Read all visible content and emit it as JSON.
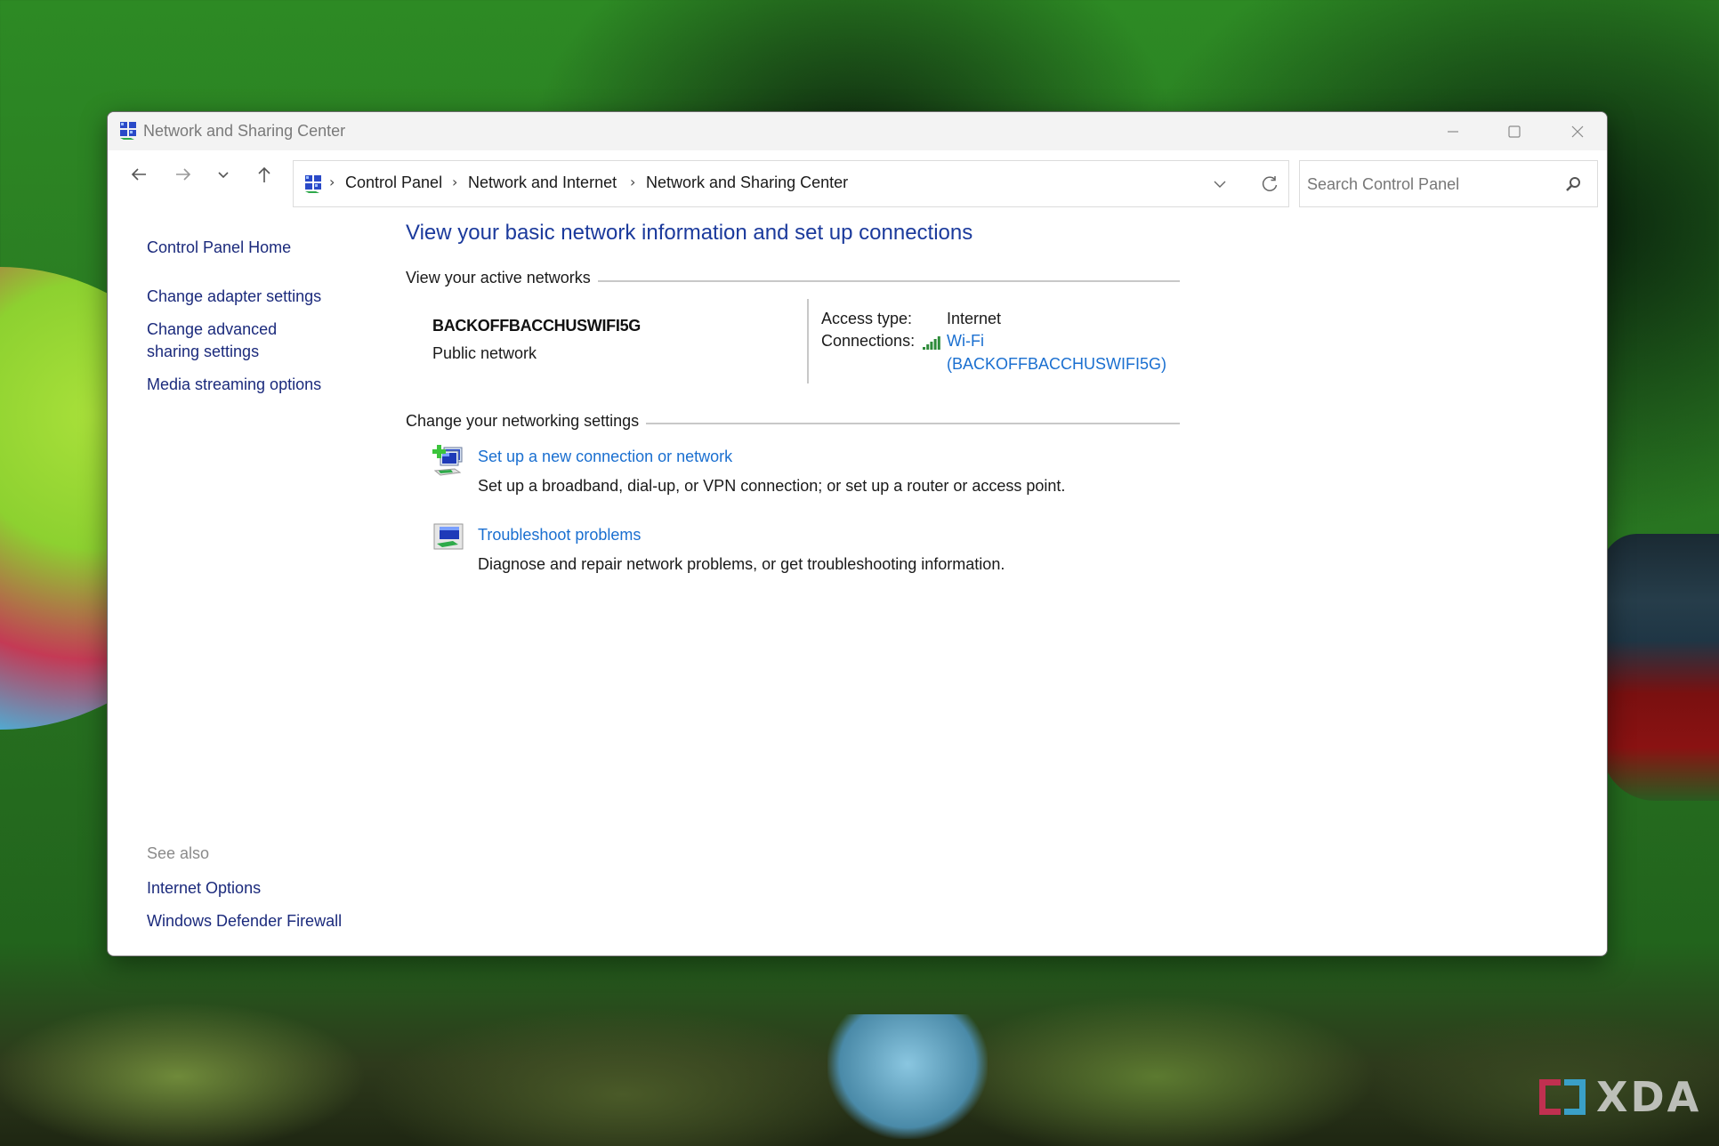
{
  "window": {
    "title": "Network and Sharing Center",
    "controls": {
      "minimize": "minimize",
      "maximize": "maximize",
      "close": "close"
    }
  },
  "navigation": {
    "back_label": "Back",
    "forward_label": "Forward",
    "recent_label": "Recent locations",
    "up_label": "Up"
  },
  "breadcrumb": {
    "separator": "›",
    "items": [
      "Control Panel",
      "Network and Internet",
      "Network and Sharing Center"
    ]
  },
  "search": {
    "placeholder": "Search Control Panel",
    "value": ""
  },
  "sidebar": {
    "home": "Control Panel Home",
    "links": [
      "Change adapter settings",
      "Change advanced sharing settings",
      "Media streaming options"
    ],
    "see_also_title": "See also",
    "see_also": [
      "Internet Options",
      "Windows Defender Firewall"
    ]
  },
  "main": {
    "heading": "View your basic network information and set up connections",
    "active_networks_label": "View your active networks",
    "network": {
      "name": "BACKOFFBACCHUSWIFI5G",
      "category": "Public network",
      "access_type_label": "Access type:",
      "access_type_value": "Internet",
      "connections_label": "Connections:",
      "connection_link_line1": "Wi-Fi",
      "connection_link_line2": "(BACKOFFBACCHUSWIFI5G)",
      "signal_bars": 5,
      "signal_max": 5
    },
    "change_settings_label": "Change your networking settings",
    "tasks": [
      {
        "icon": "new-connection-icon",
        "title": "Set up a new connection or network",
        "description": "Set up a broadband, dial-up, or VPN connection; or set up a router or access point."
      },
      {
        "icon": "troubleshoot-icon",
        "title": "Troubleshoot problems",
        "description": "Diagnose and repair network problems, or get troubleshooting information."
      }
    ]
  },
  "watermark": {
    "text": "XDA"
  },
  "colors": {
    "link_dark": "#1b2a7c",
    "link_blue": "#1a6fd0",
    "heading": "#1b3a9c",
    "signal": "#2e8b3a"
  }
}
